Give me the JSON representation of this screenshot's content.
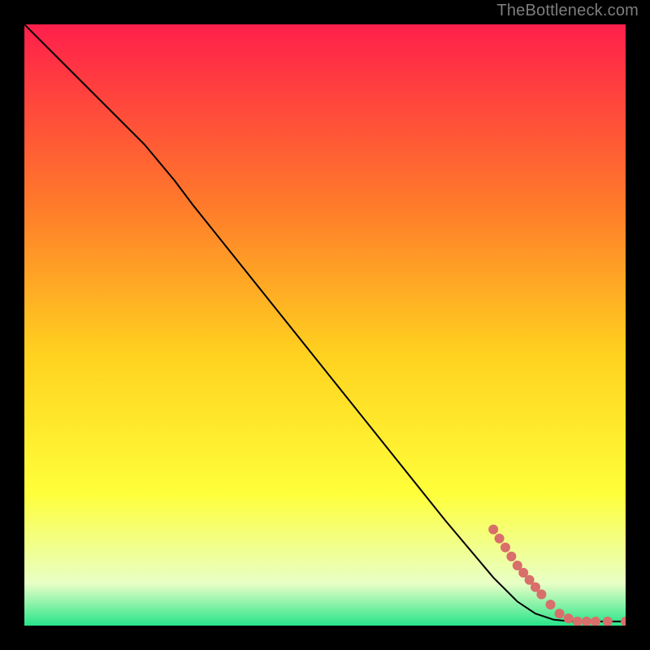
{
  "attribution": "TheBottleneck.com",
  "chart_data": {
    "type": "line",
    "title": "",
    "xlabel": "",
    "ylabel": "",
    "xlim": [
      0,
      100
    ],
    "ylim": [
      0,
      100
    ],
    "grid": false,
    "legend": false,
    "background_gradient": {
      "top": "#ff1f4b",
      "mid_high": "#ff7a2a",
      "mid": "#ffd21f",
      "mid_low": "#ffff3a",
      "low": "#e8ffc6",
      "bottom": "#28e58a"
    },
    "series": [
      {
        "name": "curve",
        "stroke": "#000000",
        "x": [
          0,
          5,
          10,
          15,
          20,
          25,
          28,
          32,
          40,
          50,
          60,
          70,
          78,
          82,
          85,
          88,
          90,
          92,
          94,
          96,
          98,
          100
        ],
        "y": [
          100,
          95,
          90,
          85,
          80,
          74,
          70,
          65,
          55,
          42.5,
          30,
          17.5,
          8,
          4,
          2,
          1,
          0.8,
          0.7,
          0.7,
          0.7,
          0.7,
          0.7
        ]
      }
    ],
    "markers": [
      {
        "name": "highlight-points",
        "color": "#d86f6a",
        "shape": "circle",
        "approx_radius_px": 6,
        "points": [
          {
            "x": 78,
            "y": 16
          },
          {
            "x": 79,
            "y": 14.5
          },
          {
            "x": 80,
            "y": 13
          },
          {
            "x": 81,
            "y": 11.5
          },
          {
            "x": 82,
            "y": 10
          },
          {
            "x": 83,
            "y": 8.8
          },
          {
            "x": 84,
            "y": 7.6
          },
          {
            "x": 85,
            "y": 6.4
          },
          {
            "x": 86,
            "y": 5.2
          },
          {
            "x": 87.5,
            "y": 3.5
          },
          {
            "x": 89,
            "y": 2
          },
          {
            "x": 90.5,
            "y": 1.2
          },
          {
            "x": 92,
            "y": 0.7
          },
          {
            "x": 93.5,
            "y": 0.7
          },
          {
            "x": 95,
            "y": 0.7
          },
          {
            "x": 97,
            "y": 0.7
          },
          {
            "x": 100,
            "y": 0.7
          }
        ]
      }
    ]
  }
}
